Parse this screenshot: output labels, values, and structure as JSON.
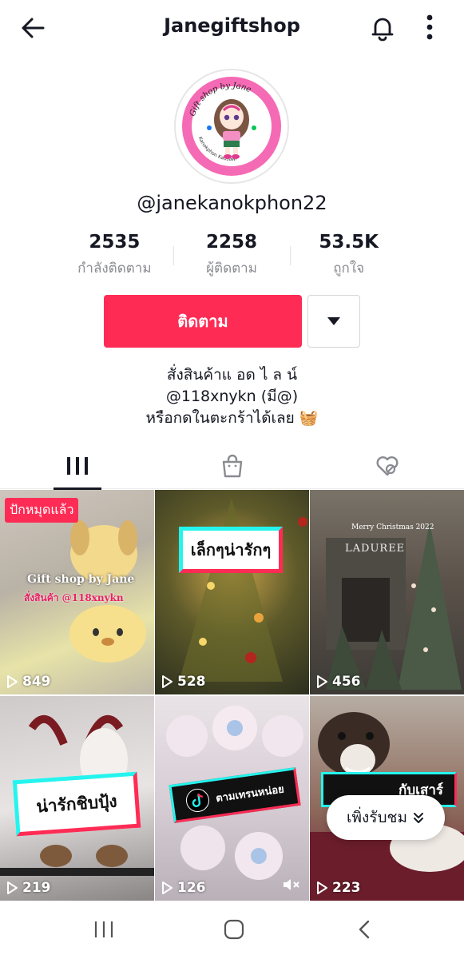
{
  "header": {
    "title": "Janegiftshop"
  },
  "avatar": {
    "ring_text": "Gift shop by Jane",
    "side_text": "Kanokphon Kaosawi",
    "line_text": "@118xnykn(มี@)"
  },
  "profile": {
    "handle": "@janekanokphon22"
  },
  "stats": [
    {
      "value": "2535",
      "label": "กำลังติดตาม"
    },
    {
      "value": "2258",
      "label": "ผู้ติดตาม"
    },
    {
      "value": "53.5K",
      "label": "ถูกใจ"
    }
  ],
  "actions": {
    "follow_label": "ติดตาม"
  },
  "bio": {
    "line1": "สั่งสินค้าแ อด ไ ล น์",
    "line2": "@118xnykn (มี@)",
    "line3": "หรือกดในตะกร้าได้เลย 🧺"
  },
  "tabs": [
    "videos-tab",
    "shop-tab",
    "liked-tab"
  ],
  "videos": [
    {
      "views": "849",
      "pinned_label": "ปักหมุดแล้ว",
      "overlay1": "Gift shop by Jane",
      "overlay2": "สั่งสินค้า @118xnykn"
    },
    {
      "views": "528",
      "sticker": "เล็กๆน่ารักๆ"
    },
    {
      "views": "456",
      "overlay1": "Merry Christmas 2022",
      "overlay2": "LADUREE"
    },
    {
      "views": "219",
      "sticker": "น่ารักชิบปุ้ง"
    },
    {
      "views": "126",
      "sticker": "ตามเทรนหน่อย"
    },
    {
      "views": "223",
      "sticker": "กับเสาร์"
    }
  ],
  "recently_watched": {
    "label": "เพิ่งรับชม"
  },
  "colors": {
    "accent": "#fe2c55",
    "text": "#161823",
    "muted": "#8a8b91"
  }
}
